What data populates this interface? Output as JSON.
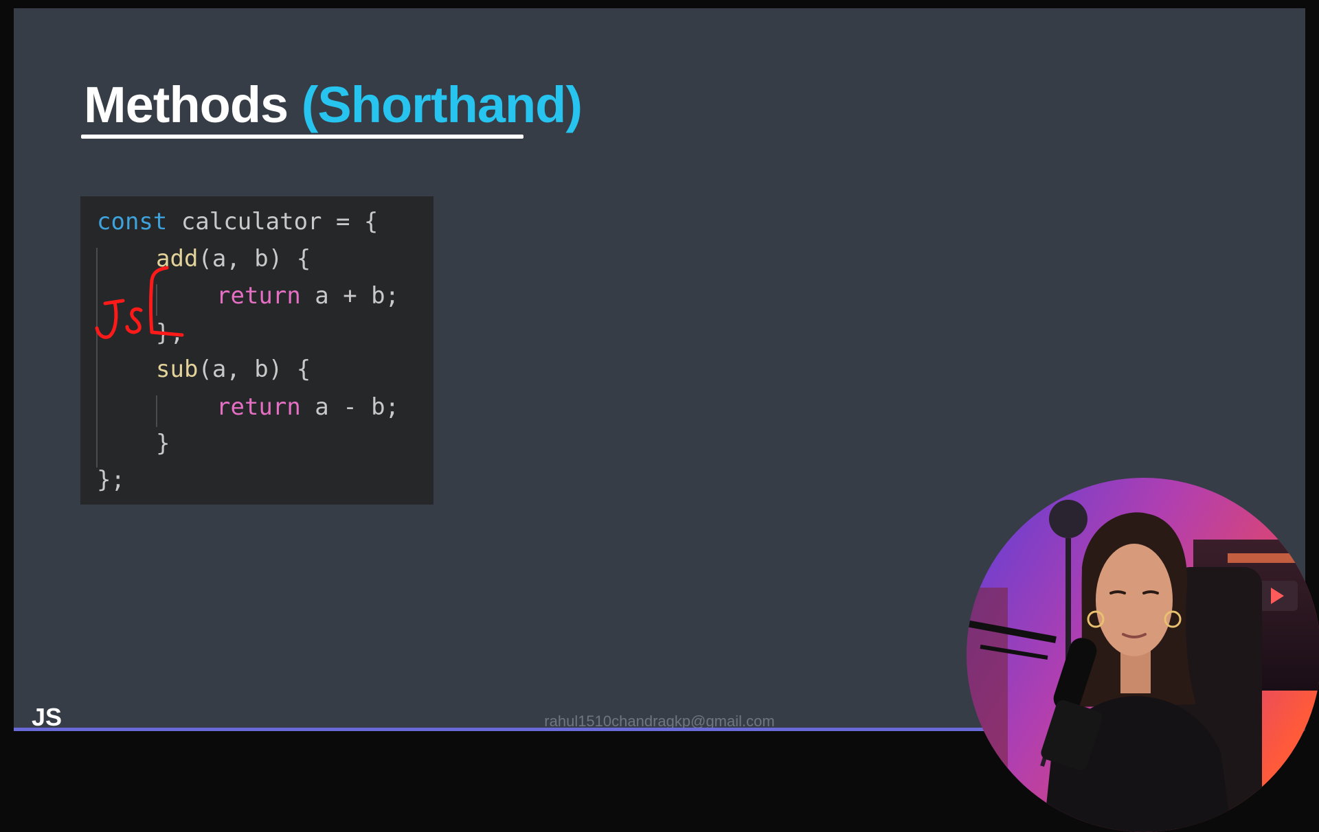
{
  "slide": {
    "title_main": "Methods",
    "title_accent": "(Shorthand)",
    "colors": {
      "background": "#363d46",
      "accent": "#27c4ef",
      "code_background": "#262729",
      "keyword_blue": "#3ea2dc",
      "keyword_pink": "#e46fc3",
      "function_name": "#e3d39b",
      "annotation": "#ff1a1a"
    },
    "code": {
      "line1": {
        "keyword": "const",
        "rest": " calculator = {"
      },
      "line2": {
        "fn": "add",
        "rest": "(a, b) {"
      },
      "line3": {
        "keyword": "return",
        "rest": " a + b;"
      },
      "line4": {
        "text": "},"
      },
      "line5": {
        "fn": "sub",
        "rest": "(a, b) {"
      },
      "line6": {
        "keyword": "return",
        "rest": " a - b;"
      },
      "line7": {
        "text": "}"
      },
      "line8": {
        "text": "};"
      }
    },
    "annotation": {
      "handwritten_text": "JS",
      "shape": "bracket"
    },
    "footer": {
      "logo": "JS",
      "email": "rahul1510chandragkp@gmail.com"
    },
    "progress": {
      "percent": 86
    },
    "webcam": {
      "icon": "presenter-webcam"
    }
  }
}
